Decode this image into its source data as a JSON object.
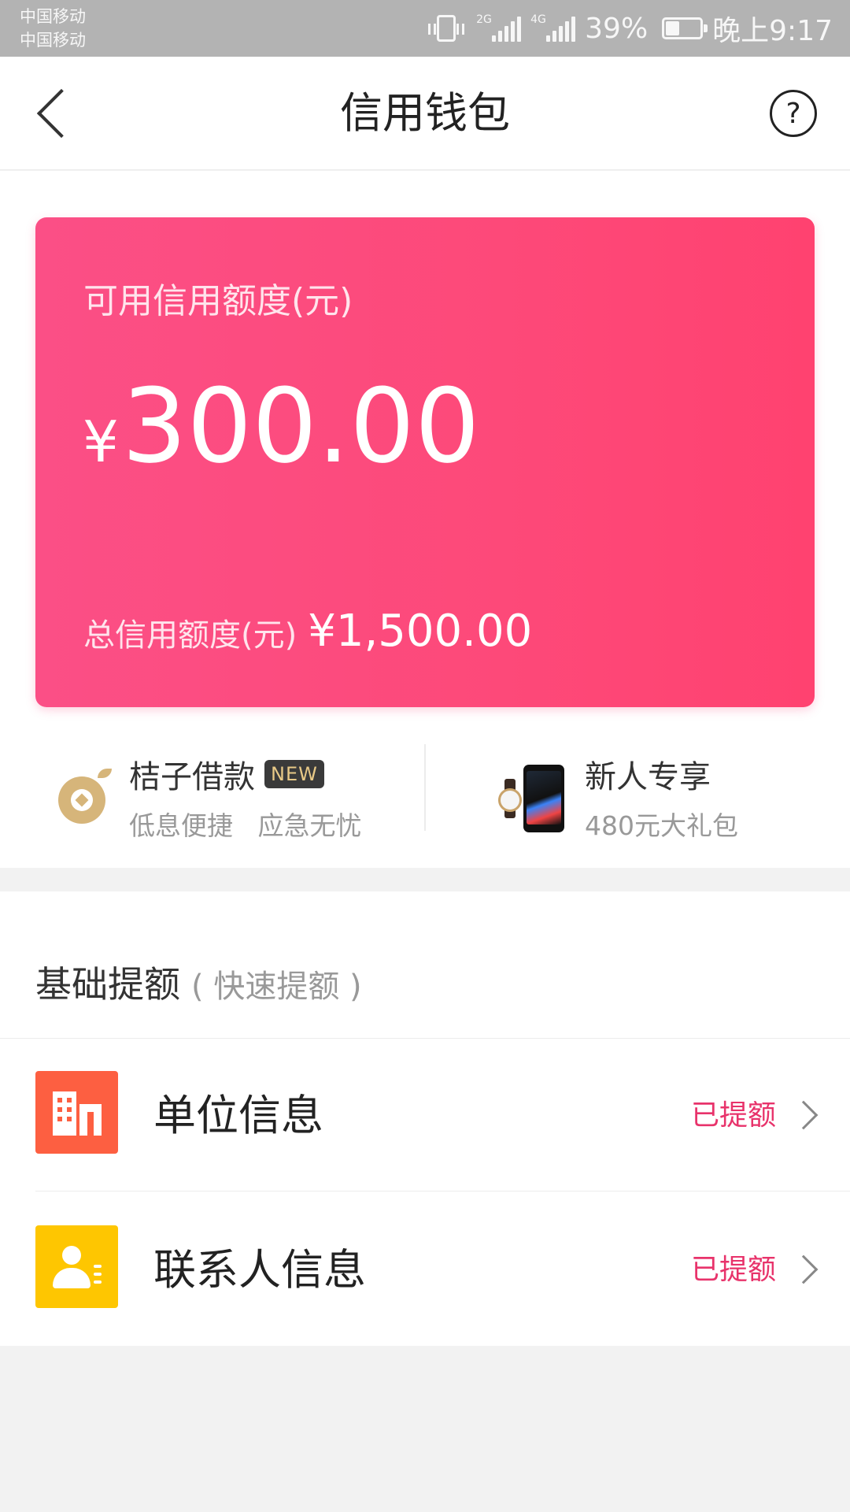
{
  "status_bar": {
    "carrier_1": "中国移动",
    "carrier_2": "中国移动",
    "network_1": "2G",
    "network_2": "4G",
    "battery_percent": "39%",
    "battery_level": 0.39,
    "time": "晚上9:17"
  },
  "header": {
    "title": "信用钱包",
    "back_icon": "chevron-left-icon",
    "help_icon": "question-circle-icon"
  },
  "credit_card": {
    "available_label": "可用信用额度(元)",
    "currency_symbol": "¥",
    "available_amount": "300.00",
    "total_label": "总信用额度(元)",
    "total_amount": "¥1,500.00",
    "gradient_colors": [
      "#fb4f86",
      "#ff4270"
    ]
  },
  "promos": [
    {
      "title": "桔子借款",
      "badge": "NEW",
      "subtitle": "低息便捷   应急无忧",
      "icon": "orange-coin-icon"
    },
    {
      "title": "新人专享",
      "subtitle": "480元大礼包",
      "icon": "phone-watch-icon"
    }
  ],
  "section": {
    "title": "基础提额",
    "subtitle": "( 快速提额 )"
  },
  "items": [
    {
      "label": "单位信息",
      "status": "已提额",
      "icon": "building-icon",
      "icon_color": "#fd5f41"
    },
    {
      "label": "联系人信息",
      "status": "已提额",
      "icon": "contact-icon",
      "icon_color": "#fec601"
    }
  ],
  "colors": {
    "accent": "#e8336b",
    "page_background": "#f2f2f2"
  }
}
